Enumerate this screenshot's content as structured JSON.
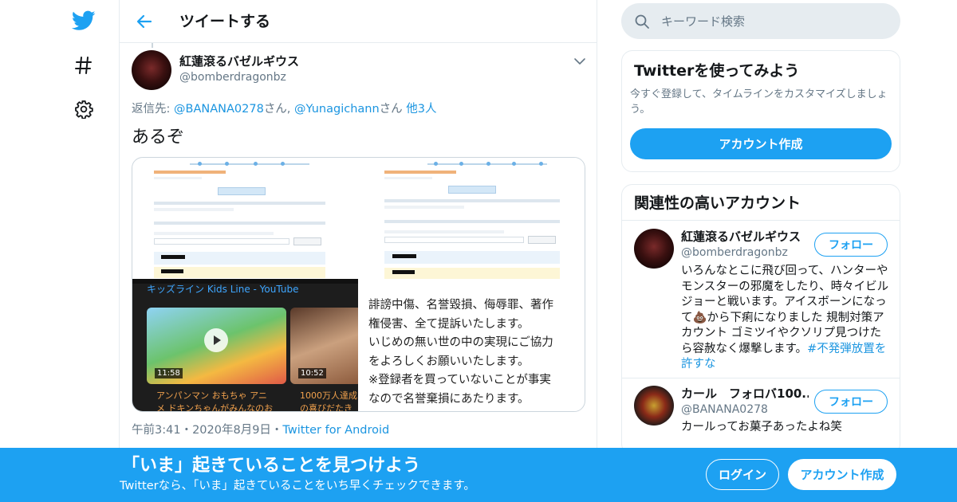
{
  "colors": {
    "brand": "#1da1f2",
    "link": "#1b95e0",
    "muted": "#657786",
    "border": "#e6ecf0"
  },
  "nav": [
    {
      "icon": "twitter-bird-icon"
    },
    {
      "icon": "hashtag-icon"
    },
    {
      "icon": "settings-gear-icon"
    }
  ],
  "header": {
    "back_icon": "back-arrow-icon",
    "title": "ツイートする"
  },
  "tweet": {
    "author_name": "紅蓮滾るバゼルギウス",
    "author_handle": "@bomberdragonbz",
    "reply_prefix": "返信先: ",
    "reply_user1": "@BANANA0278",
    "reply_san1": "さん, ",
    "reply_user2": "@Yunagichann",
    "reply_san2": "さん",
    "reply_others": "他3人",
    "text": "あるぞ",
    "media": {
      "video_title": "キッズライン Kids Line - YouTube",
      "thumb1_duration": "11:58",
      "thumb2_duration": "10:52",
      "caption1_line1": "アンパンマン おもちゃ アニ",
      "caption1_line2": "メ ドキンちゃんがみんなのお",
      "caption2_line1": "1000万人達成",
      "caption2_line2": "の喜びだたき",
      "text_lines": [
        "誹謗中傷、名誉毀損、侮辱罪、著作",
        "権侵害、全て提訴いたします。",
        "いじめの無い世の中の実現にご協力",
        "をよろしくお願いいたします。",
        "※登録者を買っていないことが事実",
        "なので名誉棄損にあたります。"
      ]
    },
    "time": "午前3:41",
    "sep1": "・",
    "date": "2020年8月9日",
    "sep2": "・",
    "source": "Twitter for Android"
  },
  "search": {
    "placeholder": "キーワード検索"
  },
  "signup_card": {
    "title": "Twitterを使ってみよう",
    "desc": "今すぐ登録して、タイムラインをカスタマイズしましょう。",
    "button": "アカウント作成"
  },
  "related": {
    "title": "関連性の高いアカウント",
    "accounts": [
      {
        "name": "紅蓮滾るバゼルギウス",
        "handle": "@bomberdragonbz",
        "follow": "フォロー",
        "bio": "いろんなとこに飛び回って、ハンターやモンスターの邪魔をしたり、時々イビルジョーと戦います。アイスボーンになって💩から下痢になりました 規制対策アカウント ゴミツイやクソリプ見つけたら容赦なく爆撃します。",
        "bio_hashtag": "#不発弾放置を許すな"
      },
      {
        "name": "カール　フォロバ100...",
        "handle": "@BANANA0278",
        "follow": "フォロー",
        "bio": "カールってお菓子あったよね笑"
      }
    ]
  },
  "banner": {
    "title": "「いま」起きていることを見つけよう",
    "subtitle": "Twitterなら、「いま」起きていることをいち早くチェックできます。",
    "login": "ログイン",
    "signup": "アカウント作成"
  }
}
